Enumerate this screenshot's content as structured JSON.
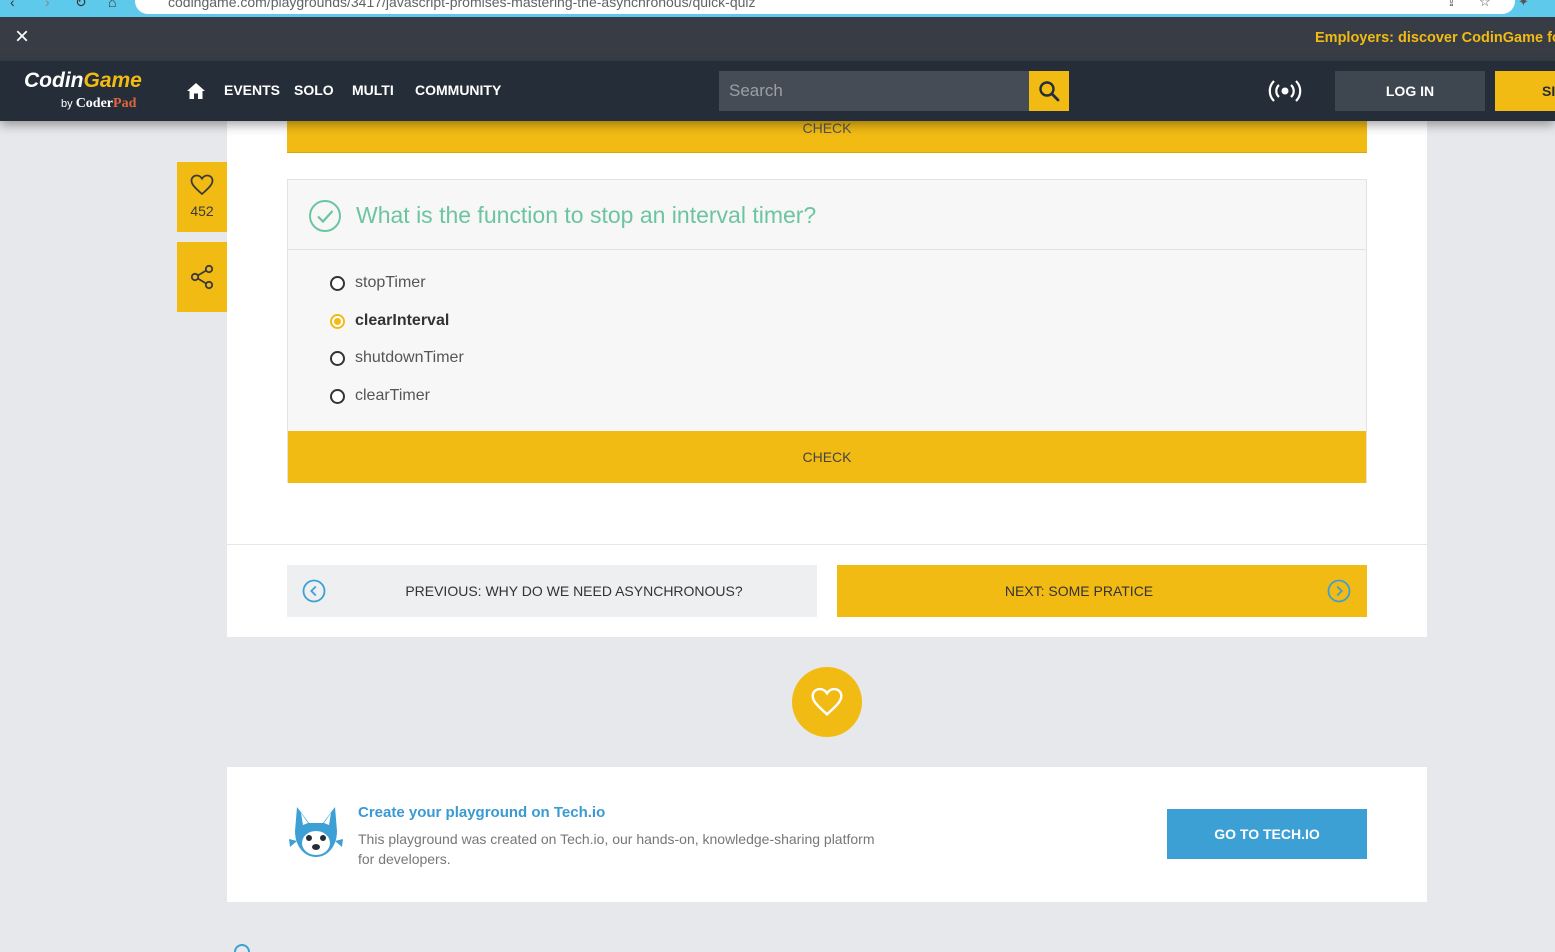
{
  "browser": {
    "url": "codingame.com/playgrounds/3417/javascript-promises-mastering-the-asynchronous/quick-quiz"
  },
  "announcement": {
    "close_icon": "close-icon",
    "text": "Employers: discover CodinGame for"
  },
  "header": {
    "logo": {
      "brand_main": "Codin",
      "brand_accent": "Game",
      "by": "by",
      "sub_main": "Coder",
      "sub_accent": "Pad"
    },
    "nav": [
      {
        "label": "EVENTS"
      },
      {
        "label": "SOLO"
      },
      {
        "label": "MULTI"
      },
      {
        "label": "COMMUNITY"
      }
    ],
    "search": {
      "placeholder": "Search"
    },
    "login_label": "LOG IN",
    "signup_label": "SI"
  },
  "sidebar": {
    "like_count": "452"
  },
  "quiz": {
    "top_check_label": "CHECK",
    "question": "What is the function to stop an interval timer?",
    "options": [
      {
        "label": "stopTimer",
        "selected": false
      },
      {
        "label": "clearInterval",
        "selected": true
      },
      {
        "label": "shutdownTimer",
        "selected": false
      },
      {
        "label": "clearTimer",
        "selected": false
      }
    ],
    "check_label": "CHECK"
  },
  "pagination": {
    "previous_label": "PREVIOUS: WHY DO WE NEED ASYNCHRONOUS?",
    "next_label": "NEXT: SOME PRATICE"
  },
  "promo": {
    "title": "Create your playground on Tech.io",
    "description": "This playground was created on Tech.io, our hands-on, knowledge-sharing platform for developers.",
    "button_label": "GO TO TECH.IO"
  },
  "colors": {
    "accent": "#f2bb13",
    "header_bg": "#252e38",
    "correct_green": "#6cc5a0",
    "techio_blue": "#3da0d5"
  }
}
